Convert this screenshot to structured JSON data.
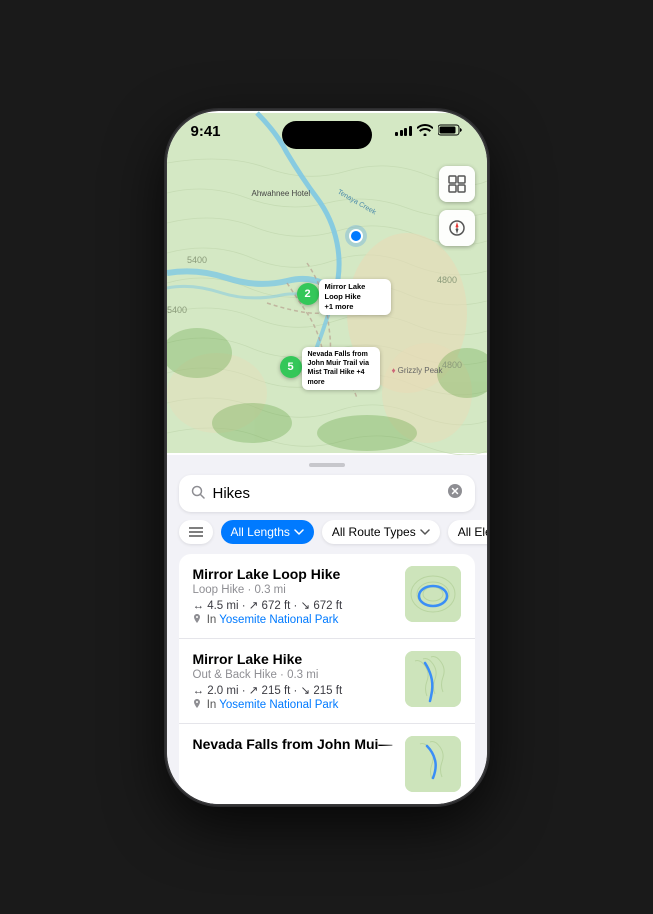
{
  "status_bar": {
    "time": "9:41",
    "location_arrow": "▶"
  },
  "map": {
    "clusters": [
      {
        "id": "cluster-2",
        "count": "2",
        "top": "185",
        "left": "138"
      },
      {
        "id": "cluster-5",
        "count": "5",
        "top": "258",
        "left": "118"
      }
    ],
    "labels": [
      {
        "id": "mirror-lake-label",
        "text": "Mirror Lake Loop Hike\n+1 more",
        "top": "195",
        "left": "155"
      },
      {
        "id": "nevada-falls-label",
        "text": "Nevada Falls from John Muir Trail via Mist Trail Hike +4 more",
        "top": "262",
        "left": "135"
      },
      {
        "id": "grizzly-peak-label",
        "text": "Grizzly Peak",
        "top": "262",
        "left": "248"
      },
      {
        "id": "ahwahnee-label",
        "text": "Ahwahnee Hotel",
        "top": "80",
        "left": "100"
      }
    ],
    "user_location": {
      "top": "122",
      "left": "190"
    }
  },
  "controls": {
    "map_type_icon": "⊞",
    "compass_icon": "◎"
  },
  "search": {
    "query": "Hikes",
    "placeholder": "Search",
    "clear_label": "✕"
  },
  "filters": [
    {
      "id": "filter-list",
      "label": "≡",
      "active": false,
      "icon_only": true
    },
    {
      "id": "filter-lengths",
      "label": "All Lengths",
      "active": true,
      "has_chevron": true
    },
    {
      "id": "filter-route-types",
      "label": "All Route Types",
      "active": false,
      "has_chevron": true
    },
    {
      "id": "filter-elevation",
      "label": "All Ele",
      "active": false,
      "has_chevron": true
    }
  ],
  "results": [
    {
      "id": "result-1",
      "name": "Mirror Lake Loop Hike",
      "type": "Loop Hike · 0.3 mi",
      "stats": "↔ 4.5 mi · ↗ 672 ft · ↘ 672 ft",
      "location": "Yosemite National Park",
      "thumbnail_type": "loop"
    },
    {
      "id": "result-2",
      "name": "Mirror Lake Hike",
      "type": "Out & Back Hike · 0.3 mi",
      "stats": "↔ 2.0 mi · ↗ 215 ft · ↘ 215 ft",
      "location": "Yosemite National Park",
      "thumbnail_type": "line"
    },
    {
      "id": "result-3",
      "name": "Nevada Falls from John Mui—",
      "type": "",
      "stats": "",
      "location": "",
      "thumbnail_type": "partial",
      "partial": true
    }
  ],
  "labels": {
    "in_prefix": "In",
    "distance_separator": "·"
  }
}
